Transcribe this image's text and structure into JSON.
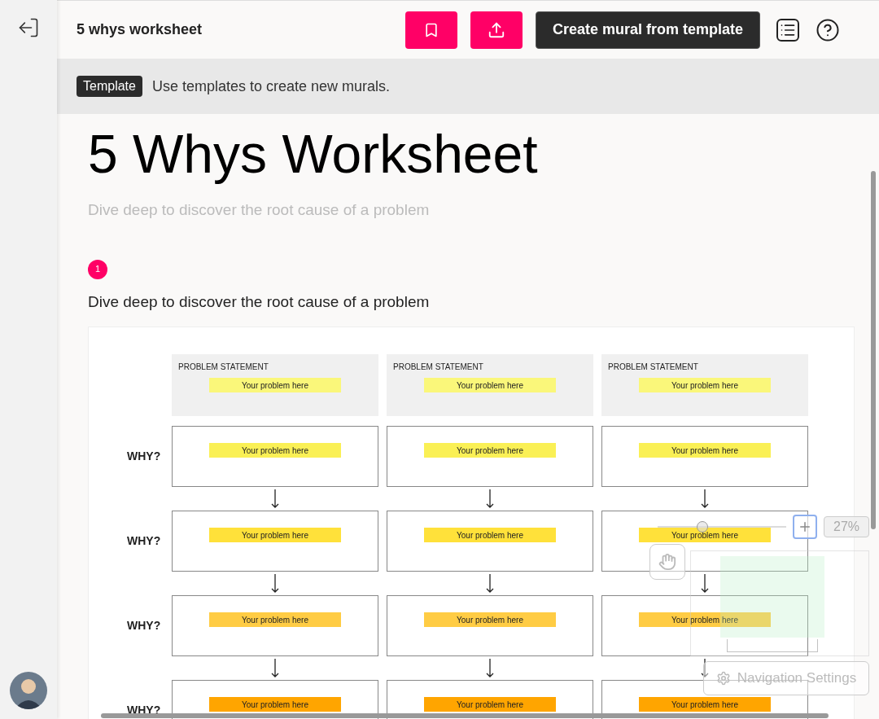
{
  "header": {
    "title": "5 whys worksheet",
    "create_button": "Create mural from template"
  },
  "banner": {
    "tag": "Template",
    "text": "Use templates to create new murals."
  },
  "page": {
    "title": "5 Whys Worksheet",
    "subtitle": "Dive deep to discover the root cause of a problem"
  },
  "step": {
    "number": "1",
    "heading": "Dive deep to discover the root cause of a problem"
  },
  "worksheet": {
    "columns": [
      {
        "label": "PROBLEM STATEMENT",
        "note": "Your problem here"
      },
      {
        "label": "PROBLEM STATEMENT",
        "note": "Your problem here"
      },
      {
        "label": "PROBLEM STATEMENT",
        "note": "Your problem here"
      }
    ],
    "rows": [
      {
        "label": "WHY?",
        "color": "#faf055",
        "notes": [
          "Your problem here",
          "Your problem here",
          "Your problem here"
        ]
      },
      {
        "label": "WHY?",
        "color": "#ffe13a",
        "notes": [
          "Your problem here",
          "Your problem here",
          "Your problem here"
        ]
      },
      {
        "label": "WHY?",
        "color": "#ffcc44",
        "notes": [
          "Your problem here",
          "Your problem here",
          "Your problem here"
        ]
      },
      {
        "label": "WHY?",
        "color": "#ffa500",
        "notes": [
          "Your problem here",
          "Your problem here",
          "Your problem here"
        ]
      }
    ]
  },
  "navigation": {
    "zoom_slider": {
      "level": 0.35
    },
    "zoom": "27%",
    "settings_button": "Navigation Settings"
  }
}
